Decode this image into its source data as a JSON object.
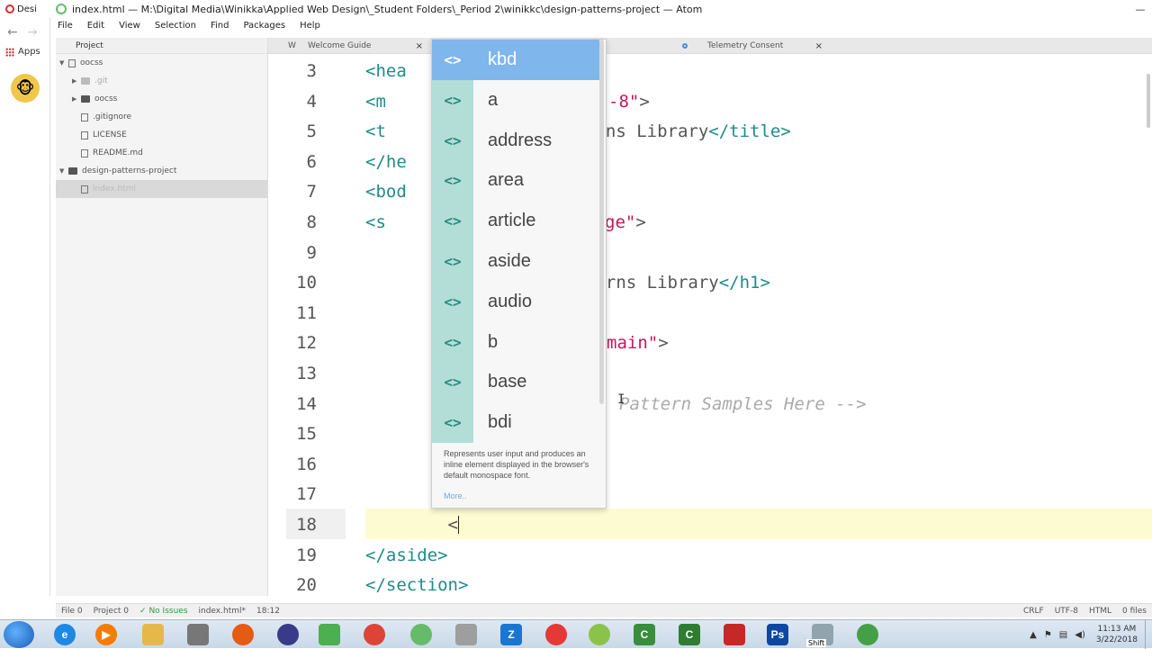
{
  "window": {
    "chrome_tab": "Desi",
    "title": "index.html — M:\\Digital Media\\Winikka\\Applied Web Design\\_Student Folders\\_Period 2\\winikkc\\design-patterns-project — Atom"
  },
  "menu": [
    "File",
    "Edit",
    "View",
    "Selection",
    "Find",
    "Packages",
    "Help"
  ],
  "browser_strip": {
    "back": "←",
    "forward": "→",
    "apps_label": "Apps"
  },
  "tree": {
    "header": "Project",
    "rows": [
      {
        "label": "oocss",
        "arrow": "▼",
        "kind": "repo",
        "indent": 0
      },
      {
        "label": ".git",
        "arrow": "▶",
        "kind": "folder",
        "indent": 1,
        "dim": true
      },
      {
        "label": "oocss",
        "arrow": "▶",
        "kind": "folder",
        "indent": 1
      },
      {
        "label": ".gitignore",
        "arrow": "",
        "kind": "file",
        "indent": 1
      },
      {
        "label": "LICENSE",
        "arrow": "",
        "kind": "file",
        "indent": 1
      },
      {
        "label": "README.md",
        "arrow": "",
        "kind": "file",
        "indent": 1
      },
      {
        "label": "design-patterns-project",
        "arrow": "▼",
        "kind": "folder",
        "indent": 0
      },
      {
        "label": "index.html",
        "arrow": "",
        "kind": "file",
        "indent": 1,
        "selected": true
      }
    ]
  },
  "tabs": {
    "partial": "W",
    "welcome": "Welcome Guide",
    "telemetry": "Telemetry Consent",
    "close": "×"
  },
  "editor": {
    "current_line": 18,
    "lines": [
      {
        "n": "3",
        "html": "<span class='t-tag'>&lt;hea</span>"
      },
      {
        "n": "4",
        "html": "  <span class='t-tag'>&lt;m</span>"
      },
      {
        "n": "5",
        "html": "  <span class='t-tag'>&lt;t</span>"
      },
      {
        "n": "6",
        "html": "<span class='t-tag'>&lt;/he</span>"
      },
      {
        "n": "7",
        "html": "<span class='t-tag'>&lt;bod</span>"
      },
      {
        "n": "8",
        "html": "  <span class='t-tag'>&lt;s</span>"
      },
      {
        "n": "9",
        "html": ""
      },
      {
        "n": "10",
        "html": ""
      },
      {
        "n": "11",
        "html": ""
      },
      {
        "n": "12",
        "html": ""
      },
      {
        "n": "13",
        "html": ""
      },
      {
        "n": "14",
        "html": ""
      },
      {
        "n": "15",
        "html": ""
      },
      {
        "n": "16",
        "html": ""
      },
      {
        "n": "17",
        "html": ""
      },
      {
        "n": "18",
        "html": "        &lt;<span class='caret'></span>"
      },
      {
        "n": "19",
        "html": "    <span class='t-tag'>&lt;/aside&gt;</span>"
      },
      {
        "n": "20",
        "html": "  <span class='t-tag'>&lt;/section&gt;</span>"
      }
    ],
    "right_fragments": [
      {
        "line": "4",
        "html": "<span class='t-str'>-8\"</span>&gt;"
      },
      {
        "line": "5",
        "html": "erns Library<span class='t-tag'>&lt;/title&gt;</span>"
      },
      {
        "line": "8",
        "html": "<span class='t-str'>ge\"</span>&gt;"
      },
      {
        "line": "10",
        "html": "terns Library<span class='t-tag'>&lt;/h1&gt;</span>"
      },
      {
        "line": "12",
        "html": "<span class='t-str'>main\"</span>&gt;"
      },
      {
        "line": "14",
        "html": "<span class='t-cmt'>Pattern Samples Here --&gt;</span>"
      }
    ]
  },
  "autocomplete": {
    "icon": "<>",
    "items": [
      "kbd",
      "a",
      "address",
      "area",
      "article",
      "aside",
      "audio",
      "b",
      "base",
      "bdi"
    ],
    "selected_index": 0,
    "description": "Represents user input and produces an inline element displayed in the browser's default monospace font.",
    "more": "More.."
  },
  "status": {
    "file": "File 0",
    "project": "Project 0",
    "issues": "✓ No Issues",
    "filename": "index.html*",
    "cursor": "18:12",
    "eol": "CRLF",
    "encoding": "UTF-8",
    "grammar": "HTML",
    "files": "0 files"
  },
  "taskbar": {
    "time": "11:13 AM",
    "date": "3/22/2018",
    "shift": "Shift"
  }
}
